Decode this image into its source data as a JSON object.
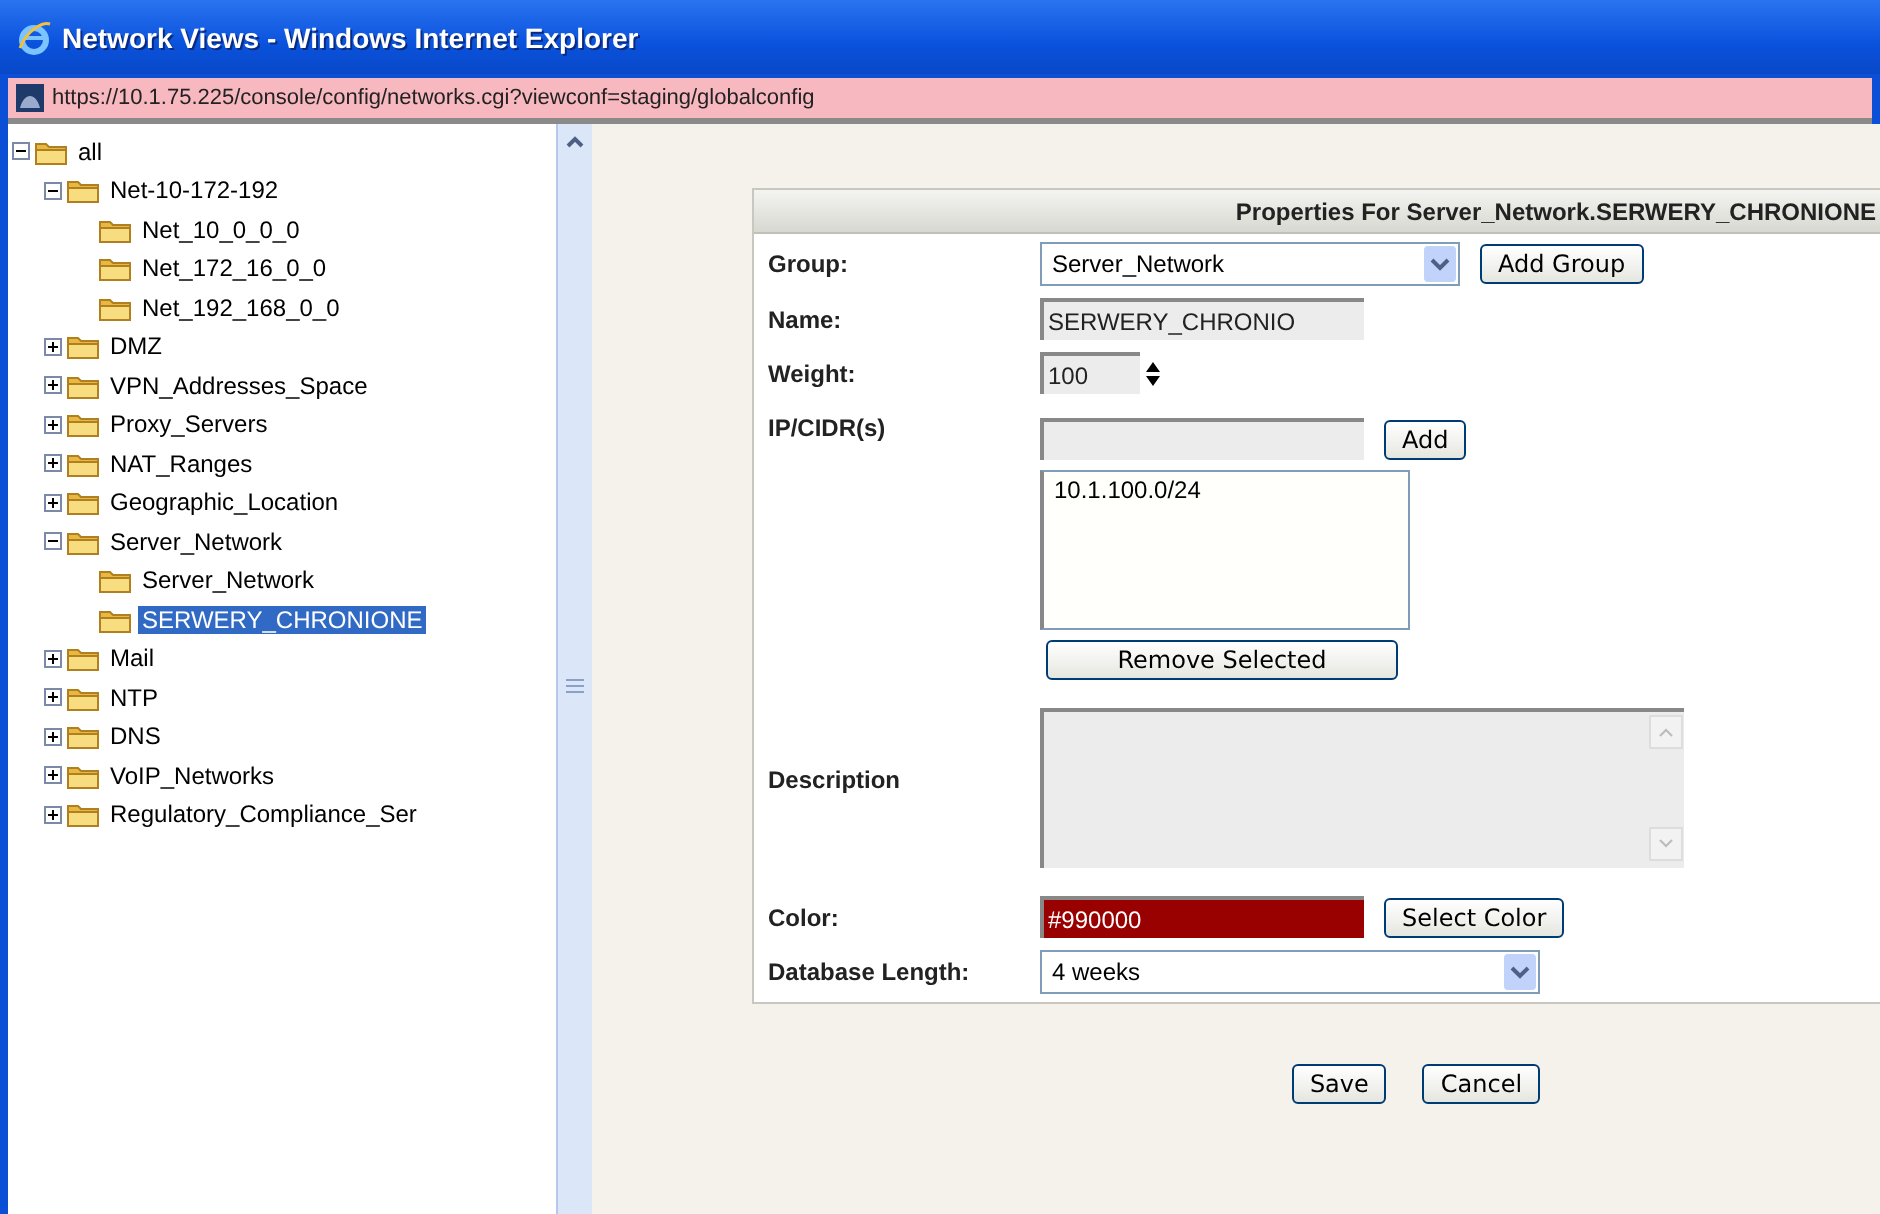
{
  "window": {
    "title": "Network Views - Windows Internet Explorer"
  },
  "address_bar": {
    "url": "https://10.1.75.225/console/config/networks.cgi?viewconf=staging/globalconfig"
  },
  "tree": [
    {
      "label": "all",
      "kind": "folder",
      "expanded": true,
      "selected": false,
      "children": [
        {
          "label": "Net-10-172-192",
          "kind": "folder",
          "expanded": true,
          "selected": false,
          "children": [
            {
              "label": "Net_10_0_0_0",
              "kind": "leaf",
              "selected": false
            },
            {
              "label": "Net_172_16_0_0",
              "kind": "leaf",
              "selected": false
            },
            {
              "label": "Net_192_168_0_0",
              "kind": "leaf",
              "selected": false
            }
          ]
        },
        {
          "label": "DMZ",
          "kind": "folder",
          "expanded": false,
          "selected": false
        },
        {
          "label": "VPN_Addresses_Space",
          "kind": "folder",
          "expanded": false,
          "selected": false
        },
        {
          "label": "Proxy_Servers",
          "kind": "folder",
          "expanded": false,
          "selected": false
        },
        {
          "label": "NAT_Ranges",
          "kind": "folder",
          "expanded": false,
          "selected": false
        },
        {
          "label": "Geographic_Location",
          "kind": "folder",
          "expanded": false,
          "selected": false
        },
        {
          "label": "Server_Network",
          "kind": "folder",
          "expanded": true,
          "selected": false,
          "children": [
            {
              "label": "Server_Network",
              "kind": "leaf",
              "selected": false
            },
            {
              "label": "SERWERY_CHRONIONE",
              "kind": "leaf",
              "selected": true
            }
          ]
        },
        {
          "label": "Mail",
          "kind": "folder",
          "expanded": false,
          "selected": false
        },
        {
          "label": "NTP",
          "kind": "folder",
          "expanded": false,
          "selected": false
        },
        {
          "label": "DNS",
          "kind": "folder",
          "expanded": false,
          "selected": false
        },
        {
          "label": "VoIP_Networks",
          "kind": "folder",
          "expanded": false,
          "selected": false
        },
        {
          "label": "Regulatory_Compliance_Ser",
          "kind": "folder",
          "expanded": false,
          "selected": false
        }
      ]
    }
  ],
  "properties": {
    "title": "Properties For Server_Network.SERWERY_CHRONIONE",
    "group": {
      "label": "Group:",
      "value": "Server_Network",
      "button": "Add Group"
    },
    "name": {
      "label": "Name:",
      "value": "SERWERY_CHRONIO"
    },
    "weight": {
      "label": "Weight:",
      "value": "100"
    },
    "ip_cidrs": {
      "label": "IP/CIDR(s)",
      "button": "Add",
      "entries": [
        "10.1.100.0/24"
      ],
      "remove_button": "Remove Selected"
    },
    "description": {
      "label": "Description"
    },
    "color": {
      "label": "Color:",
      "value": "#990000",
      "color": "#990000",
      "button": "Select Color"
    },
    "database_length": {
      "label": "Database Length:",
      "value": "4 weeks"
    }
  },
  "buttons": [
    "Save",
    "Cancel"
  ]
}
